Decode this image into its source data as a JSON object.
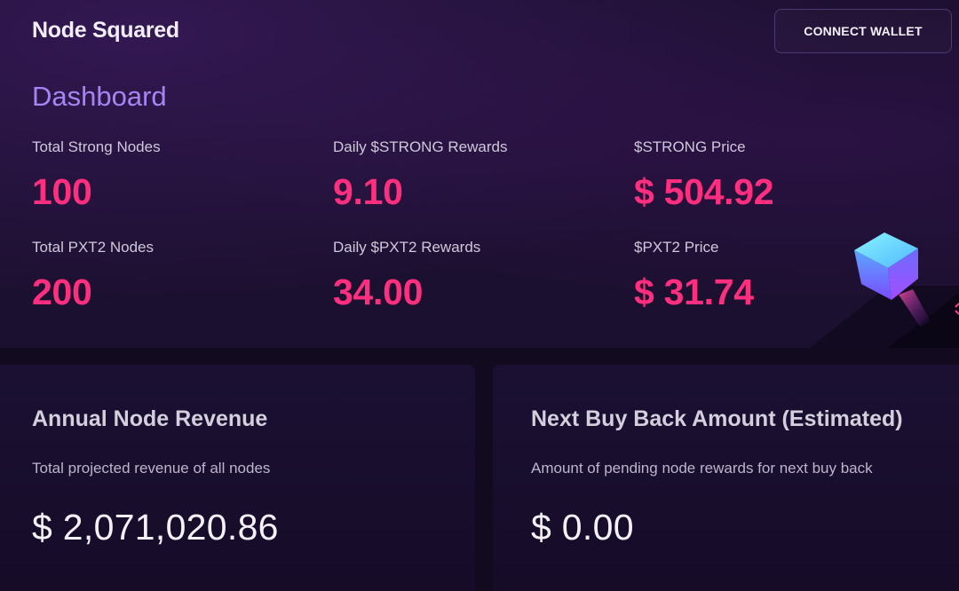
{
  "header": {
    "brand": "Node Squared",
    "connect_wallet_label": "CONNECT WALLET"
  },
  "dashboard": {
    "title": "Dashboard",
    "stats": [
      {
        "label": "Total Strong Nodes",
        "value": "100"
      },
      {
        "label": "Daily $STRONG Rewards",
        "value": "9.10"
      },
      {
        "label": "$STRONG Price",
        "value": "$ 504.92"
      },
      {
        "label": "Total PXT2 Nodes",
        "value": "200"
      },
      {
        "label": "Daily $PXT2 Rewards",
        "value": "34.00"
      },
      {
        "label": "$PXT2 Price",
        "value": "$ 31.74"
      }
    ]
  },
  "cards": [
    {
      "title": "Annual Node Revenue",
      "description": "Total projected revenue of all nodes",
      "amount": "$ 2,071,020.86"
    },
    {
      "title": "Next Buy Back Amount (Estimated)",
      "description": "Amount of pending node rewards for next buy back",
      "amount": "$ 0.00"
    }
  ],
  "colors": {
    "accent_pink": "#ff2e7e",
    "accent_purple": "#a585f2",
    "background": "#1c1030",
    "card_background": "#1b1032"
  },
  "icons": {
    "decoration": "cube-icon"
  }
}
